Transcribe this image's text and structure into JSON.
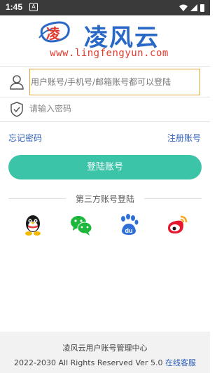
{
  "status_bar": {
    "time": "1:45",
    "notification_glyph": "A"
  },
  "logo": {
    "brand": "凌风云",
    "mark": "凌",
    "url": "www.lingfengyun.com"
  },
  "form": {
    "username_placeholder": "用户账号/手机号/邮箱账号都可以登陆",
    "password_placeholder": "请输入密码"
  },
  "links": {
    "forgot": "忘记密码",
    "register": "注册账号"
  },
  "login_button": "登陆账号",
  "third_party": {
    "title": "第三方账号登陆",
    "providers": [
      "qq-icon",
      "wechat-icon",
      "baidu-icon",
      "weibo-icon"
    ]
  },
  "footer": {
    "title": "凌风云用户账号管理中心",
    "copyright": "2022-2030 All Rights Reserved Ver 5.0",
    "support_link": "在线客服"
  },
  "colors": {
    "accent": "#3cc4a9",
    "link": "#2f5fb8",
    "brand": "#2a68c7",
    "brand_red": "#e23a2e"
  }
}
